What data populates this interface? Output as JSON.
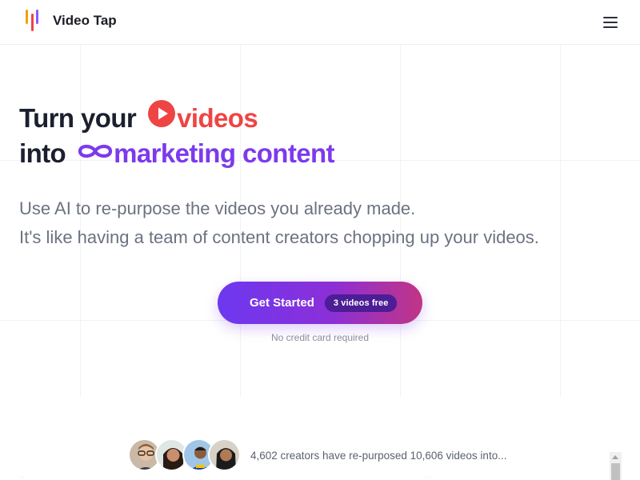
{
  "header": {
    "brand": "Video Tap",
    "logo_colors": [
      "#f59e0b",
      "#ef4444",
      "#8b5cf6"
    ],
    "menu_icon": "hamburger-menu-icon"
  },
  "hero": {
    "line1_prefix": "Turn your",
    "line1_highlight": "videos",
    "line2_prefix": "into",
    "line2_highlight": "marketing content",
    "highlight_colors": {
      "videos": "#ef4444",
      "marketing": "#7c3aed"
    },
    "icons": [
      "play-icon",
      "infinity-icon"
    ],
    "subtext_line1": "Use AI to re-purpose the videos you already made.",
    "subtext_line2": "It's like having a team of content creators chopping up your videos."
  },
  "cta": {
    "label": "Get Started",
    "badge": "3 videos free",
    "note": "No credit card required",
    "gradient": [
      "#6d38f0",
      "#c13584"
    ]
  },
  "social_proof": {
    "text": "4,602 creators have re-purposed 10,606 videos into...",
    "avatar_count": 4
  }
}
